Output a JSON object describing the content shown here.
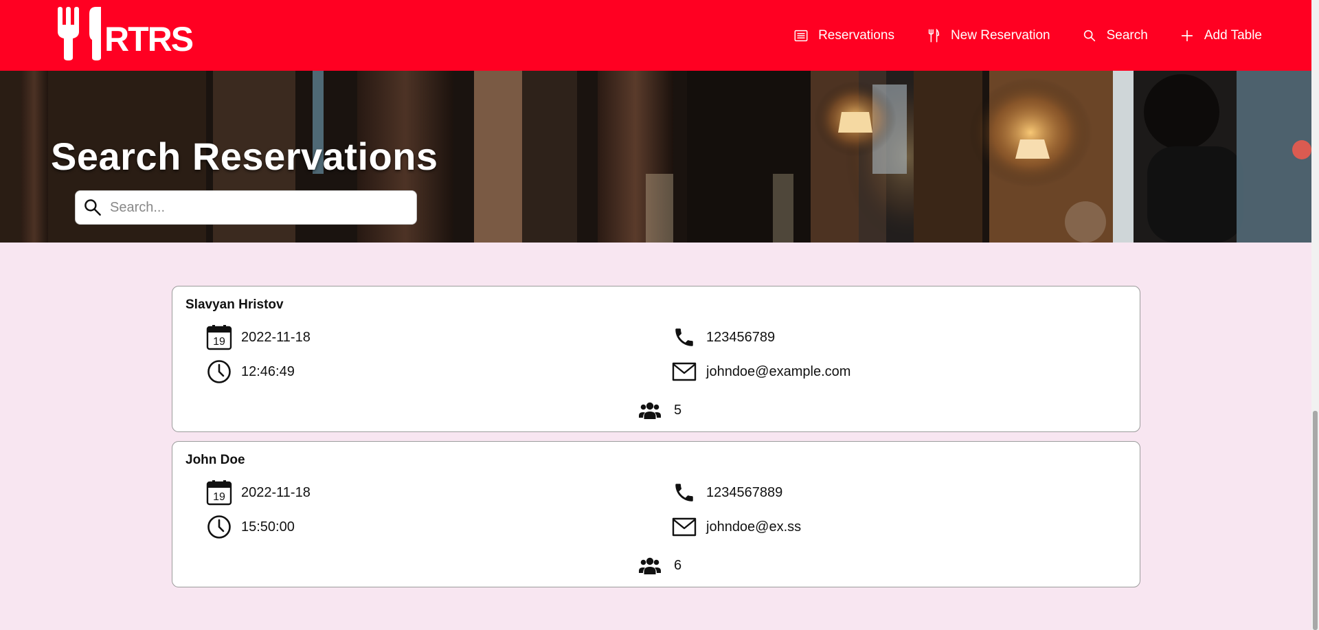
{
  "app": {
    "logo_text": "RTRS"
  },
  "nav": {
    "items": [
      {
        "label": "Reservations",
        "icon": "list-icon"
      },
      {
        "label": "New Reservation",
        "icon": "fork-knife-icon"
      },
      {
        "label": "Search",
        "icon": "search-icon"
      },
      {
        "label": "Add Table",
        "icon": "plus-icon"
      }
    ]
  },
  "hero": {
    "title": "Search Reservations",
    "search_placeholder": "Search..."
  },
  "calendar_day": "19",
  "reservations": [
    {
      "name": "Slavyan Hristov",
      "date": "2022-11-18",
      "time": "12:46:49",
      "phone": "123456789",
      "email": "johndoe@example.com",
      "guests": "5"
    },
    {
      "name": "John Doe",
      "date": "2022-11-18",
      "time": "15:50:00",
      "phone": "1234567889",
      "email": "johndoe@ex.ss",
      "guests": "6"
    }
  ],
  "colors": {
    "brand": "#ff0022",
    "background": "#f8e6f1",
    "card_border": "#9b9b9b"
  }
}
